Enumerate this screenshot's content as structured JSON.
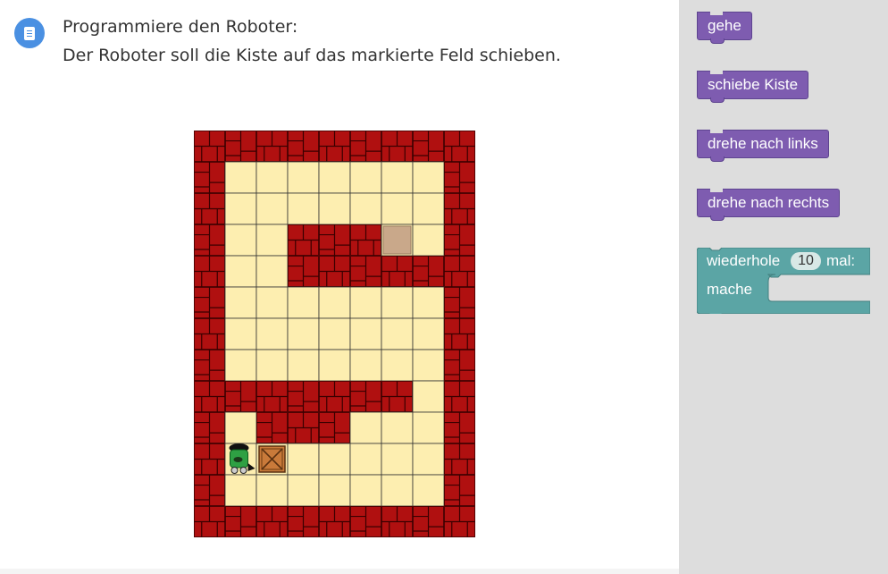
{
  "task": {
    "icon": "document-icon",
    "line1": "Programmiere den Roboter:",
    "line2": "Der Roboter soll die Kiste auf das markierte Feld schieben."
  },
  "maze": {
    "cols": 9,
    "rows": 13,
    "layout": [
      "#########",
      "#.......#",
      "#.......#",
      "#..###T.#",
      "#..#####",
      "#.......#",
      "#.......#",
      "#.......#",
      "#######.#",
      "#.###...#",
      "#RB.....#",
      "#.......#",
      "#########"
    ],
    "legend": {
      "#": "wall",
      ".": "floor",
      "T": "target",
      "R": "robot",
      "B": "box"
    },
    "colors": {
      "wall": "#b01010",
      "wall_mortar": "#3a0000",
      "floor": "#fdeeb0",
      "grid": "#333333",
      "target": "#c9a88a"
    }
  },
  "toolbox": {
    "blocks": [
      {
        "label": "gehe"
      },
      {
        "label": "schiebe Kiste"
      },
      {
        "label": "drehe nach links"
      },
      {
        "label": "drehe nach rechts"
      }
    ],
    "repeat": {
      "label_pre": "wiederhole",
      "count": "10",
      "label_post": "mal:",
      "label_do": "mache"
    },
    "colors": {
      "action": "#7e5cb0",
      "loop": "#5ba5a5",
      "background": "#dddddd"
    }
  }
}
